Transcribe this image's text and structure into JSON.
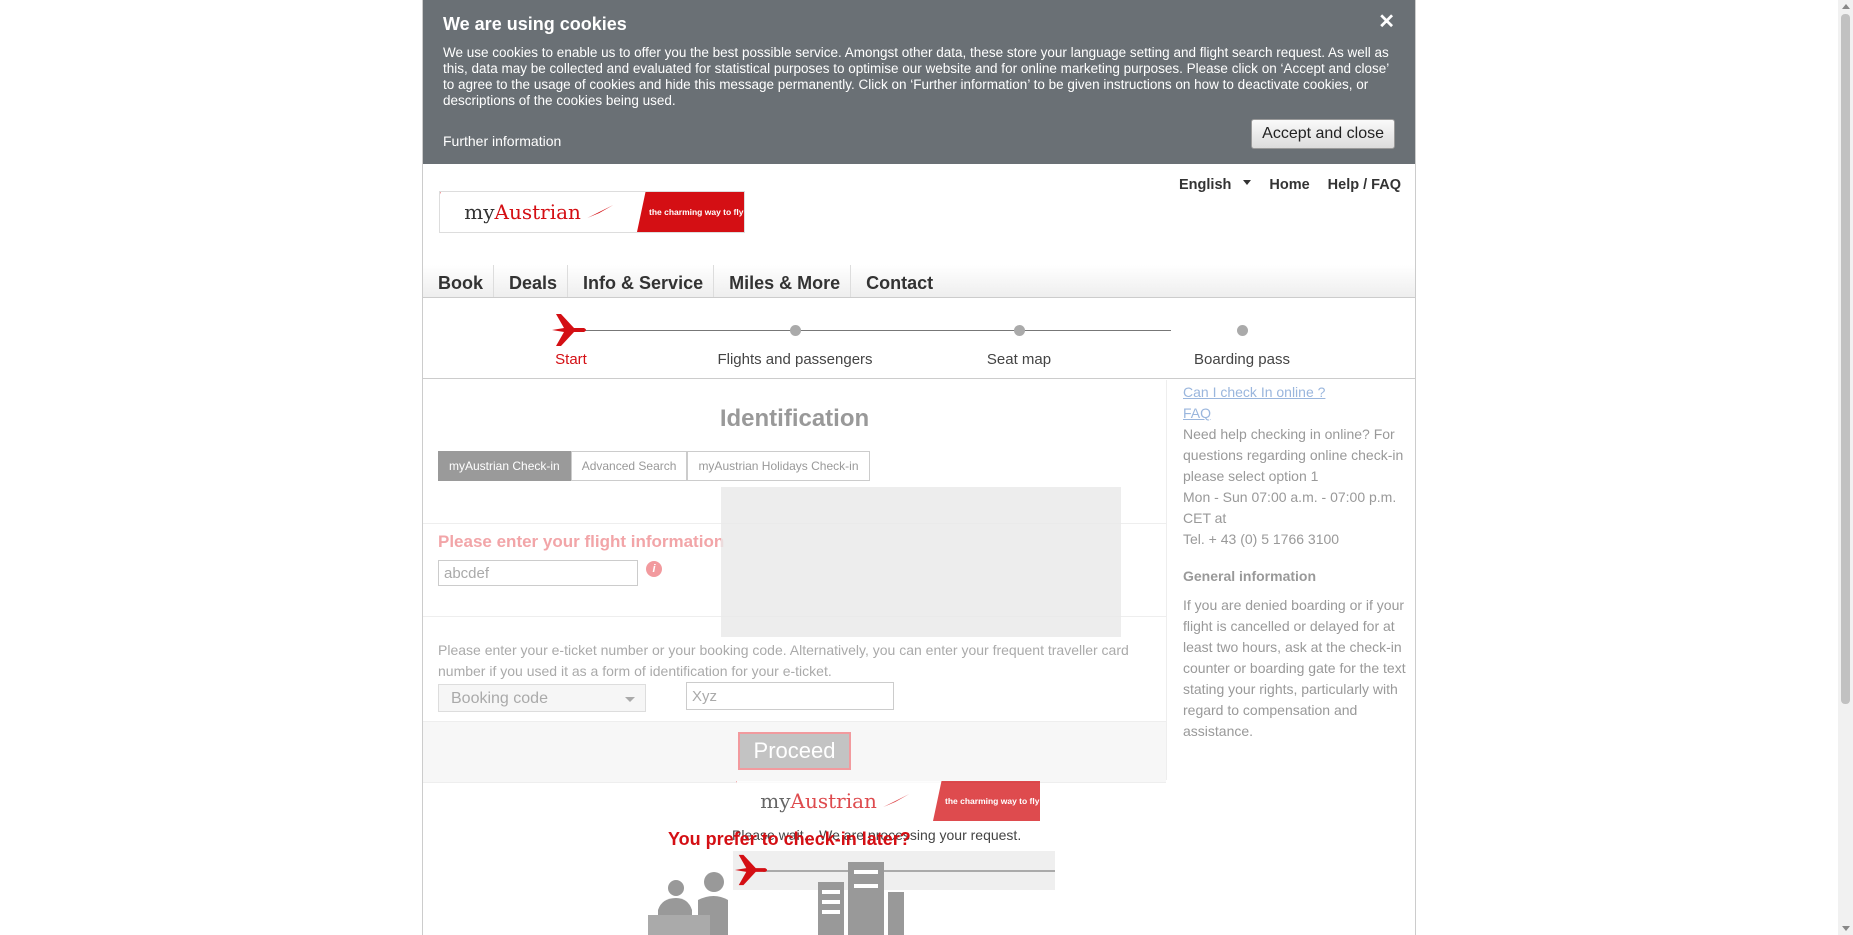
{
  "cookie": {
    "title": "We are using cookies",
    "text": "We use cookies to enable us to offer you the best possible service. Amongst other data, these store your language setting and flight search request. As well as this, data may be collected and evaluated for statistical purposes to optimise our website and for online marketing purposes. Please click on ‘Accept and close’ to agree to the usage of cookies and hide this message permanently. Click on ‘Further information’ to be given instructions on how to deactivate cookies, or descriptions of the cookies being used.",
    "further": "Further information",
    "accept": "Accept and close",
    "close": "✕"
  },
  "logo": {
    "brand_prefix": "my",
    "brand_name": "Austrian",
    "tagline": "the charming way to fly"
  },
  "topnav": {
    "language": "English",
    "home": "Home",
    "help": "Help / FAQ"
  },
  "mainnav": [
    "Book",
    "Deals",
    "Info & Service",
    "Miles & More",
    "Contact"
  ],
  "steps": [
    "Start",
    "Flights and passengers",
    "Seat map",
    "Boarding pass"
  ],
  "form": {
    "title": "Identification",
    "tabs": [
      "myAustrian Check-in",
      "Advanced Search",
      "myAustrian Holidays Check-in"
    ],
    "flight_heading": "Please enter your flight information",
    "flight_value": "abcdef",
    "info_icon": "i",
    "eticket_text": "Please enter your e-ticket number or your booking code. Alternatively, you can enter your frequent traveller card number if you used it as a form of identification for your e-ticket.",
    "select_value": "Booking code",
    "code_value": "Xyz",
    "proceed": "Proceed"
  },
  "sidebar": {
    "link1": "Can I check In online ?",
    "link2": "FAQ",
    "help_text": "Need help checking in online? For questions regarding online check-in please select option 1",
    "hours": "Mon - Sun 07:00 a.m. - 07:00 p.m. CET at",
    "tel": "Tel. + 43 (0) 5 1766 3100",
    "general_heading": "General information",
    "general_text": "If you are denied boarding or if your flight is cancelled or delayed for at least two hours, ask at the check-in counter or boarding gate for the text stating your rights, particularly with regard to compensation and assistance."
  },
  "loading": {
    "wait_text": "Please wait... We are processing your request.",
    "later_heading": "You prefer to check-in later?"
  },
  "colors": {
    "brand_red": "#d40f14",
    "banner_grey": "#6a7075"
  }
}
